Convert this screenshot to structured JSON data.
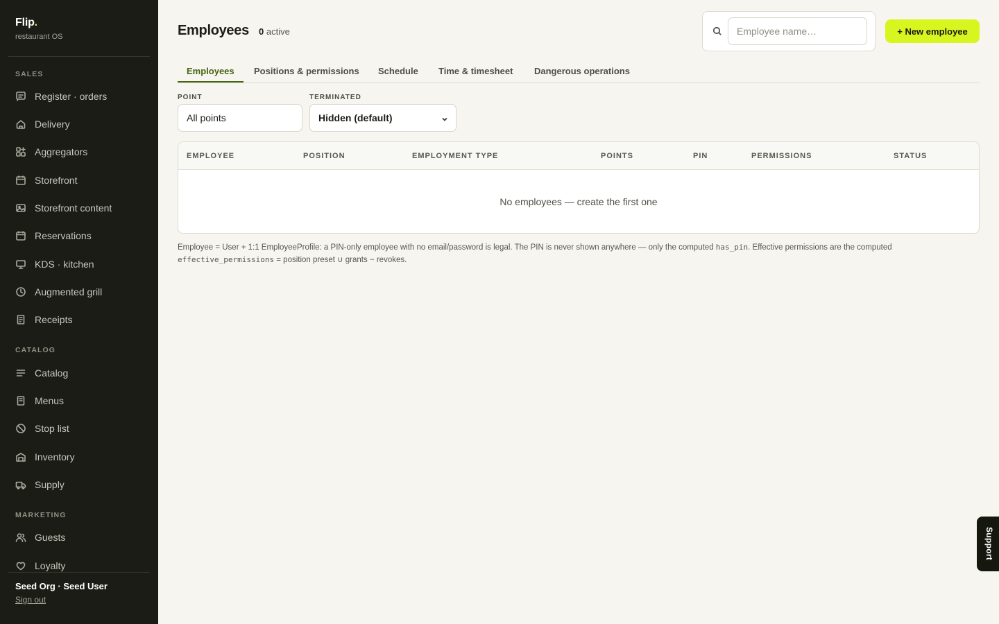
{
  "brand": {
    "name": "Flip",
    "dot": ".",
    "tagline": "restaurant OS"
  },
  "sidebar": {
    "sections": [
      {
        "label": "SALES",
        "items": [
          {
            "label": "Register · orders",
            "icon": "receipt-list-icon"
          },
          {
            "label": "Delivery",
            "icon": "home-icon"
          },
          {
            "label": "Aggregators",
            "icon": "grid-plus-icon"
          },
          {
            "label": "Storefront",
            "icon": "browser-icon"
          },
          {
            "label": "Storefront content",
            "icon": "image-icon"
          },
          {
            "label": "Reservations",
            "icon": "calendar-icon"
          },
          {
            "label": "KDS · kitchen",
            "icon": "monitor-icon"
          },
          {
            "label": "Augmented grill",
            "icon": "clock-icon"
          },
          {
            "label": "Receipts",
            "icon": "document-icon"
          }
        ]
      },
      {
        "label": "CATALOG",
        "items": [
          {
            "label": "Catalog",
            "icon": "lines-icon"
          },
          {
            "label": "Menus",
            "icon": "menu-book-icon"
          },
          {
            "label": "Stop list",
            "icon": "ban-icon"
          },
          {
            "label": "Inventory",
            "icon": "warehouse-icon"
          },
          {
            "label": "Supply",
            "icon": "truck-icon"
          }
        ]
      },
      {
        "label": "MARKETING",
        "items": [
          {
            "label": "Guests",
            "icon": "users-icon"
          },
          {
            "label": "Loyalty",
            "icon": "heart-icon"
          }
        ]
      }
    ],
    "user": "Seed Org · Seed User",
    "sign_out": "Sign out"
  },
  "header": {
    "title": "Employees",
    "active_count": "0",
    "active_label": "active",
    "search_placeholder": "Employee name…",
    "new_button": "+ New employee"
  },
  "tabs": [
    {
      "label": "Employees",
      "active": true
    },
    {
      "label": "Positions & permissions",
      "active": false
    },
    {
      "label": "Schedule",
      "active": false
    },
    {
      "label": "Time & timesheet",
      "active": false
    },
    {
      "label": "Dangerous operations",
      "active": false
    }
  ],
  "filters": {
    "point_label": "POINT",
    "point_value": "All points",
    "terminated_label": "TERMINATED",
    "terminated_value": "Hidden (default)"
  },
  "table": {
    "columns": [
      "EMPLOYEE",
      "POSITION",
      "EMPLOYMENT TYPE",
      "POINTS",
      "PIN",
      "PERMISSIONS",
      "STATUS"
    ],
    "empty_message": "No employees — create the first one"
  },
  "note": {
    "part1": "Employee = User + 1:1 EmployeeProfile: a PIN-only employee with no email/password is legal. The PIN is never shown anywhere — only the computed ",
    "code1": "has_pin",
    "part2": ". Effective permissions are the computed",
    "code2": "effective_permissions",
    "part3": " = position preset ∪ grants − revokes."
  },
  "support_label": "Support",
  "colors": {
    "accent": "#d7f51f",
    "sidebar_bg": "#1b1c16",
    "active_tab": "#466411",
    "page_bg": "#f6f5f0"
  }
}
